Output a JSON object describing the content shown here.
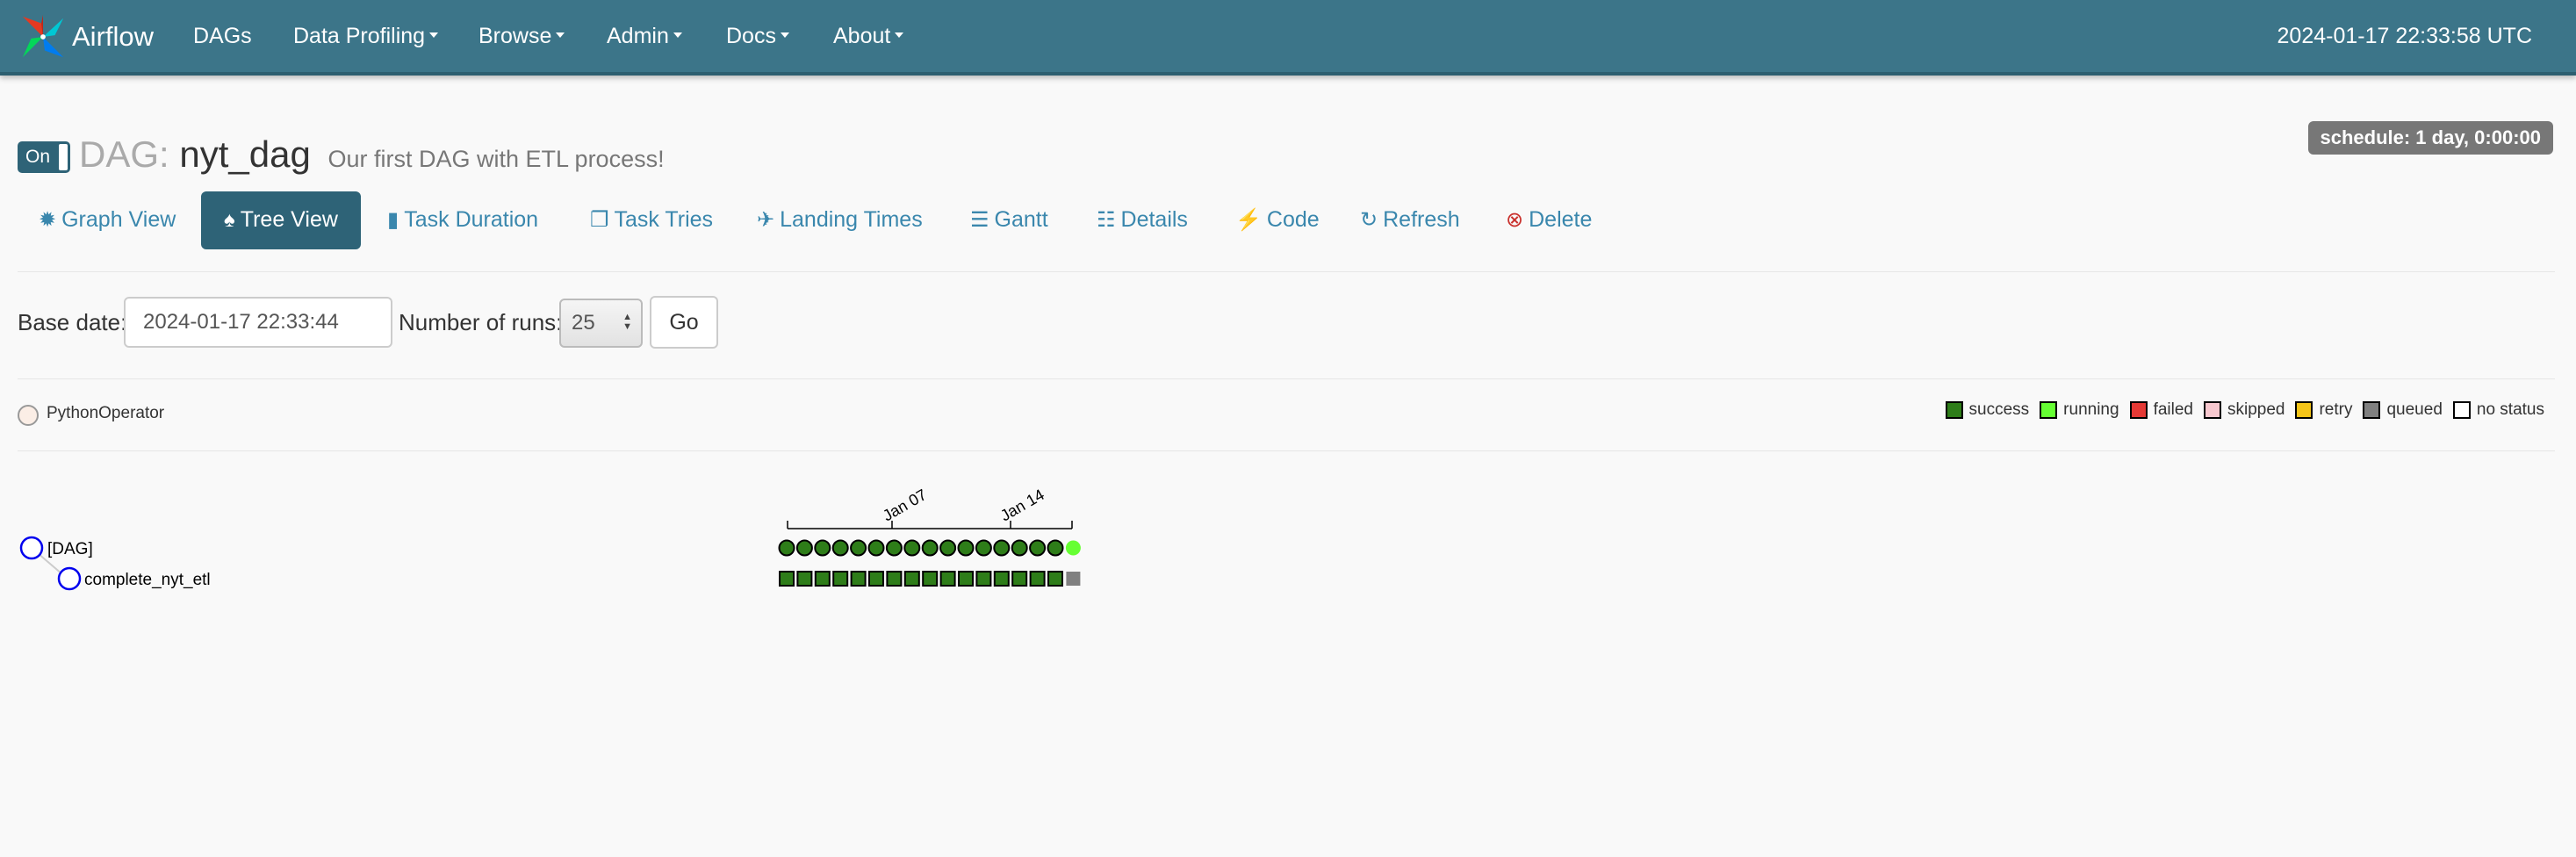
{
  "navbar": {
    "brand": "Airflow",
    "items": [
      "DAGs",
      "Data Profiling",
      "Browse",
      "Admin",
      "Docs",
      "About"
    ],
    "clock": "2024-01-17 22:33:58 UTC"
  },
  "dag": {
    "toggle_label": "On",
    "prefix": "DAG:",
    "name": "nyt_dag",
    "description": "Our first DAG with ETL process!",
    "schedule": "schedule: 1 day, 0:00:00"
  },
  "tabs": [
    {
      "label": "Graph View",
      "icon": "asterisk-icon"
    },
    {
      "label": "Tree View",
      "icon": "tree-icon",
      "active": true
    },
    {
      "label": "Task Duration",
      "icon": "bar-chart-icon"
    },
    {
      "label": "Task Tries",
      "icon": "duplicate-icon"
    },
    {
      "label": "Landing Times",
      "icon": "plane-icon"
    },
    {
      "label": "Gantt",
      "icon": "gantt-icon"
    },
    {
      "label": "Details",
      "icon": "list-icon"
    },
    {
      "label": "Code",
      "icon": "flash-icon"
    },
    {
      "label": "Refresh",
      "icon": "refresh-icon"
    },
    {
      "label": "Delete",
      "icon": "remove-circle-icon"
    }
  ],
  "form": {
    "base_date_label": "Base date:",
    "base_date_value": "2024-01-17 22:33:44",
    "runs_label": "Number of runs:",
    "runs_value": "25",
    "go_label": "Go"
  },
  "operators": [
    {
      "name": "PythonOperator",
      "color": "#fbeee6"
    }
  ],
  "legend": [
    {
      "label": "success",
      "color": "#2e7d19"
    },
    {
      "label": "running",
      "color": "#66ff33"
    },
    {
      "label": "failed",
      "color": "#e53935"
    },
    {
      "label": "skipped",
      "color": "#f8c8cf"
    },
    {
      "label": "retry",
      "color": "#f5c518"
    },
    {
      "label": "queued",
      "color": "#808080"
    },
    {
      "label": "no status",
      "color": "#ffffff"
    }
  ],
  "tree": {
    "nodes": [
      "[DAG]",
      "complete_nyt_etl"
    ],
    "date_ticks": [
      "Jan 07",
      "Jan 14"
    ],
    "dag_runs": [
      "success",
      "success",
      "success",
      "success",
      "success",
      "success",
      "success",
      "success",
      "success",
      "success",
      "success",
      "success",
      "success",
      "success",
      "success",
      "success",
      "running"
    ],
    "task_instances": [
      "success",
      "success",
      "success",
      "success",
      "success",
      "success",
      "success",
      "success",
      "success",
      "success",
      "success",
      "success",
      "success",
      "success",
      "success",
      "success",
      "queued"
    ]
  }
}
